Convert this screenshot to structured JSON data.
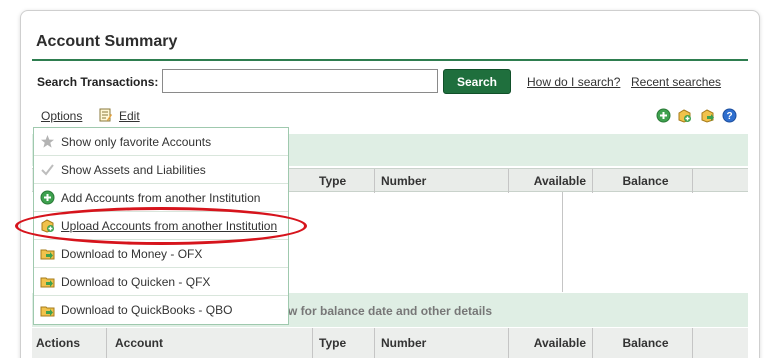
{
  "header": {
    "title": "Account Summary"
  },
  "search": {
    "label": "Search Transactions:",
    "value": "",
    "placeholder": "",
    "button_label": "Search",
    "help_link": "How do I search?",
    "recent_link": "Recent searches"
  },
  "toolbar": {
    "options_label": "Options",
    "edit_label": "Edit",
    "icons": [
      "add-icon",
      "upload-icon",
      "download-icon",
      "help-icon"
    ]
  },
  "menu": {
    "items": [
      {
        "label": "Show only favorite Accounts",
        "icon": "star-icon"
      },
      {
        "label": "Show Assets and Liabilities",
        "icon": "check-icon"
      },
      {
        "label": "Add Accounts from another Institution",
        "icon": "add-icon"
      },
      {
        "label": "Upload Accounts from another Institution",
        "icon": "upload-icon"
      },
      {
        "label": "Download to Money - OFX",
        "icon": "download-icon"
      },
      {
        "label": "Download to Quicken - QFX",
        "icon": "download-icon"
      },
      {
        "label": "Download to QuickBooks - QBO",
        "icon": "download-icon"
      }
    ]
  },
  "table1": {
    "columns": [
      "Type",
      "Number",
      "Available",
      "Balance"
    ]
  },
  "table2": {
    "hint": "w for balance date and other details",
    "columns": [
      "Actions",
      "Account",
      "Type",
      "Number",
      "Available",
      "Balance"
    ]
  },
  "colors": {
    "accent": "#1f6f3d",
    "annotation": "#d6141c",
    "band": "#dfeee4"
  }
}
